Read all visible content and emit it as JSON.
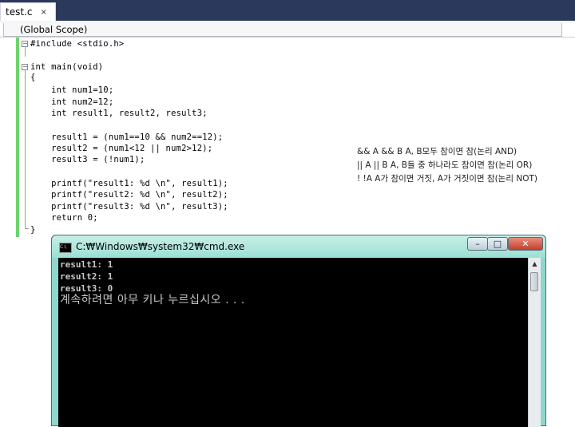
{
  "tab": {
    "label": "test.c",
    "close": "×"
  },
  "scope": {
    "label": "(Global Scope)"
  },
  "code": {
    "line1": "#include <stdio.h>",
    "line2": "int main(void)",
    "line3": "{",
    "line4": "    int num1=10;",
    "line5": "    int num2=12;",
    "line6": "    int result1, result2, result3;",
    "line7": "    result1 = (num1==10 && num2==12);",
    "line8": "    result2 = (num1<12 || num2>12);",
    "line9": "    result3 = (!num1);",
    "line10": "    printf(\"result1: %d \\n\", result1);",
    "line11": "    printf(\"result2: %d \\n\", result2);",
    "line12": "    printf(\"result3: %d \\n\", result3);",
    "line13": "    return 0;",
    "line14": "}"
  },
  "notes": [
    "&& A && B A, B모두 참이면 참(논리 AND)",
    "|| A || B A, B들 중 하나라도 참이면 참(논리 OR)",
    "! !A A가 참이면 거짓, A가 거짓이면 참(논리 NOT)"
  ],
  "cmd": {
    "title": "C:₩Windows₩system32₩cmd.exe",
    "output": [
      "result1: 1",
      "result2: 1",
      "result3: 0"
    ],
    "prompt": "계속하려면 아무 키나 누르십시오 . . ."
  }
}
